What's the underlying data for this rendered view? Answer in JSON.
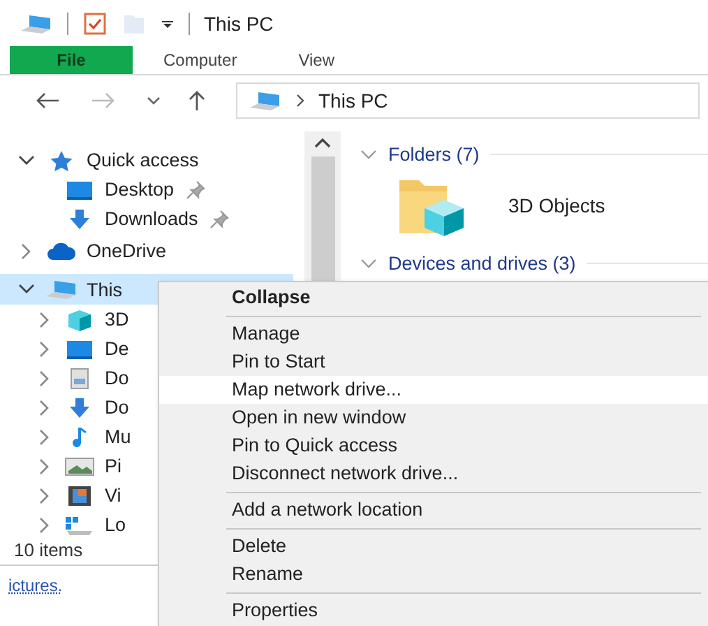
{
  "title_bar": {
    "title": "This PC"
  },
  "ribbon": {
    "tabs": [
      {
        "label": "File",
        "selected": true
      },
      {
        "label": "Computer",
        "selected": false
      },
      {
        "label": "View",
        "selected": false
      }
    ]
  },
  "address_bar": {
    "path": "This PC"
  },
  "navigation_pane": {
    "items": [
      {
        "label": "Quick access",
        "kind": "star",
        "expanded": true,
        "selected": false,
        "children": [
          {
            "label": "Desktop",
            "kind": "desktop",
            "pinned": true,
            "selected": false
          },
          {
            "label": "Downloads",
            "kind": "download",
            "pinned": true,
            "selected": false
          }
        ]
      },
      {
        "label": "OneDrive",
        "kind": "cloud",
        "expanded": false,
        "selected": false
      },
      {
        "label": "This",
        "kind": "pc",
        "expanded": true,
        "selected": true,
        "children": [
          {
            "label": "3D",
            "kind": "cube",
            "expanded": false,
            "selected": false
          },
          {
            "label": "De",
            "kind": "desktop",
            "expanded": false,
            "selected": false
          },
          {
            "label": "Do",
            "kind": "document",
            "expanded": false,
            "selected": false
          },
          {
            "label": "Do",
            "kind": "download",
            "expanded": false,
            "selected": false
          },
          {
            "label": "Mu",
            "kind": "music",
            "expanded": false,
            "selected": false
          },
          {
            "label": "Pi",
            "kind": "pictures",
            "expanded": false,
            "selected": false
          },
          {
            "label": "Vi",
            "kind": "video",
            "expanded": false,
            "selected": false
          },
          {
            "label": "Lo",
            "kind": "drive",
            "expanded": false,
            "selected": false
          }
        ]
      }
    ]
  },
  "content": {
    "groups": [
      {
        "title": "Folders (7)",
        "expanded": true,
        "items": [
          {
            "label": "3D Objects"
          }
        ]
      },
      {
        "title": "Devices and drives (3)",
        "expanded": true
      }
    ]
  },
  "status_bar": {
    "text": "10 items"
  },
  "page_text": "ictures.",
  "context_menu": {
    "items": [
      {
        "kind": "item",
        "label": "Collapse",
        "default": true,
        "selected": false
      },
      {
        "kind": "separator"
      },
      {
        "kind": "item",
        "label": "Manage",
        "default": false,
        "selected": false
      },
      {
        "kind": "item",
        "label": "Pin to Start",
        "default": false,
        "selected": false
      },
      {
        "kind": "item",
        "label": "Map network drive...",
        "default": false,
        "selected": true
      },
      {
        "kind": "item",
        "label": "Open in new window",
        "default": false,
        "selected": false
      },
      {
        "kind": "item",
        "label": "Pin to Quick access",
        "default": false,
        "selected": false
      },
      {
        "kind": "item",
        "label": "Disconnect network drive...",
        "default": false,
        "selected": false
      },
      {
        "kind": "separator"
      },
      {
        "kind": "item",
        "label": "Add a network location",
        "default": false,
        "selected": false
      },
      {
        "kind": "separator"
      },
      {
        "kind": "item",
        "label": "Delete",
        "default": false,
        "selected": false
      },
      {
        "kind": "item",
        "label": "Rename",
        "default": false,
        "selected": false
      },
      {
        "kind": "separator"
      },
      {
        "kind": "item",
        "label": "Properties",
        "default": false,
        "selected": false
      }
    ]
  }
}
